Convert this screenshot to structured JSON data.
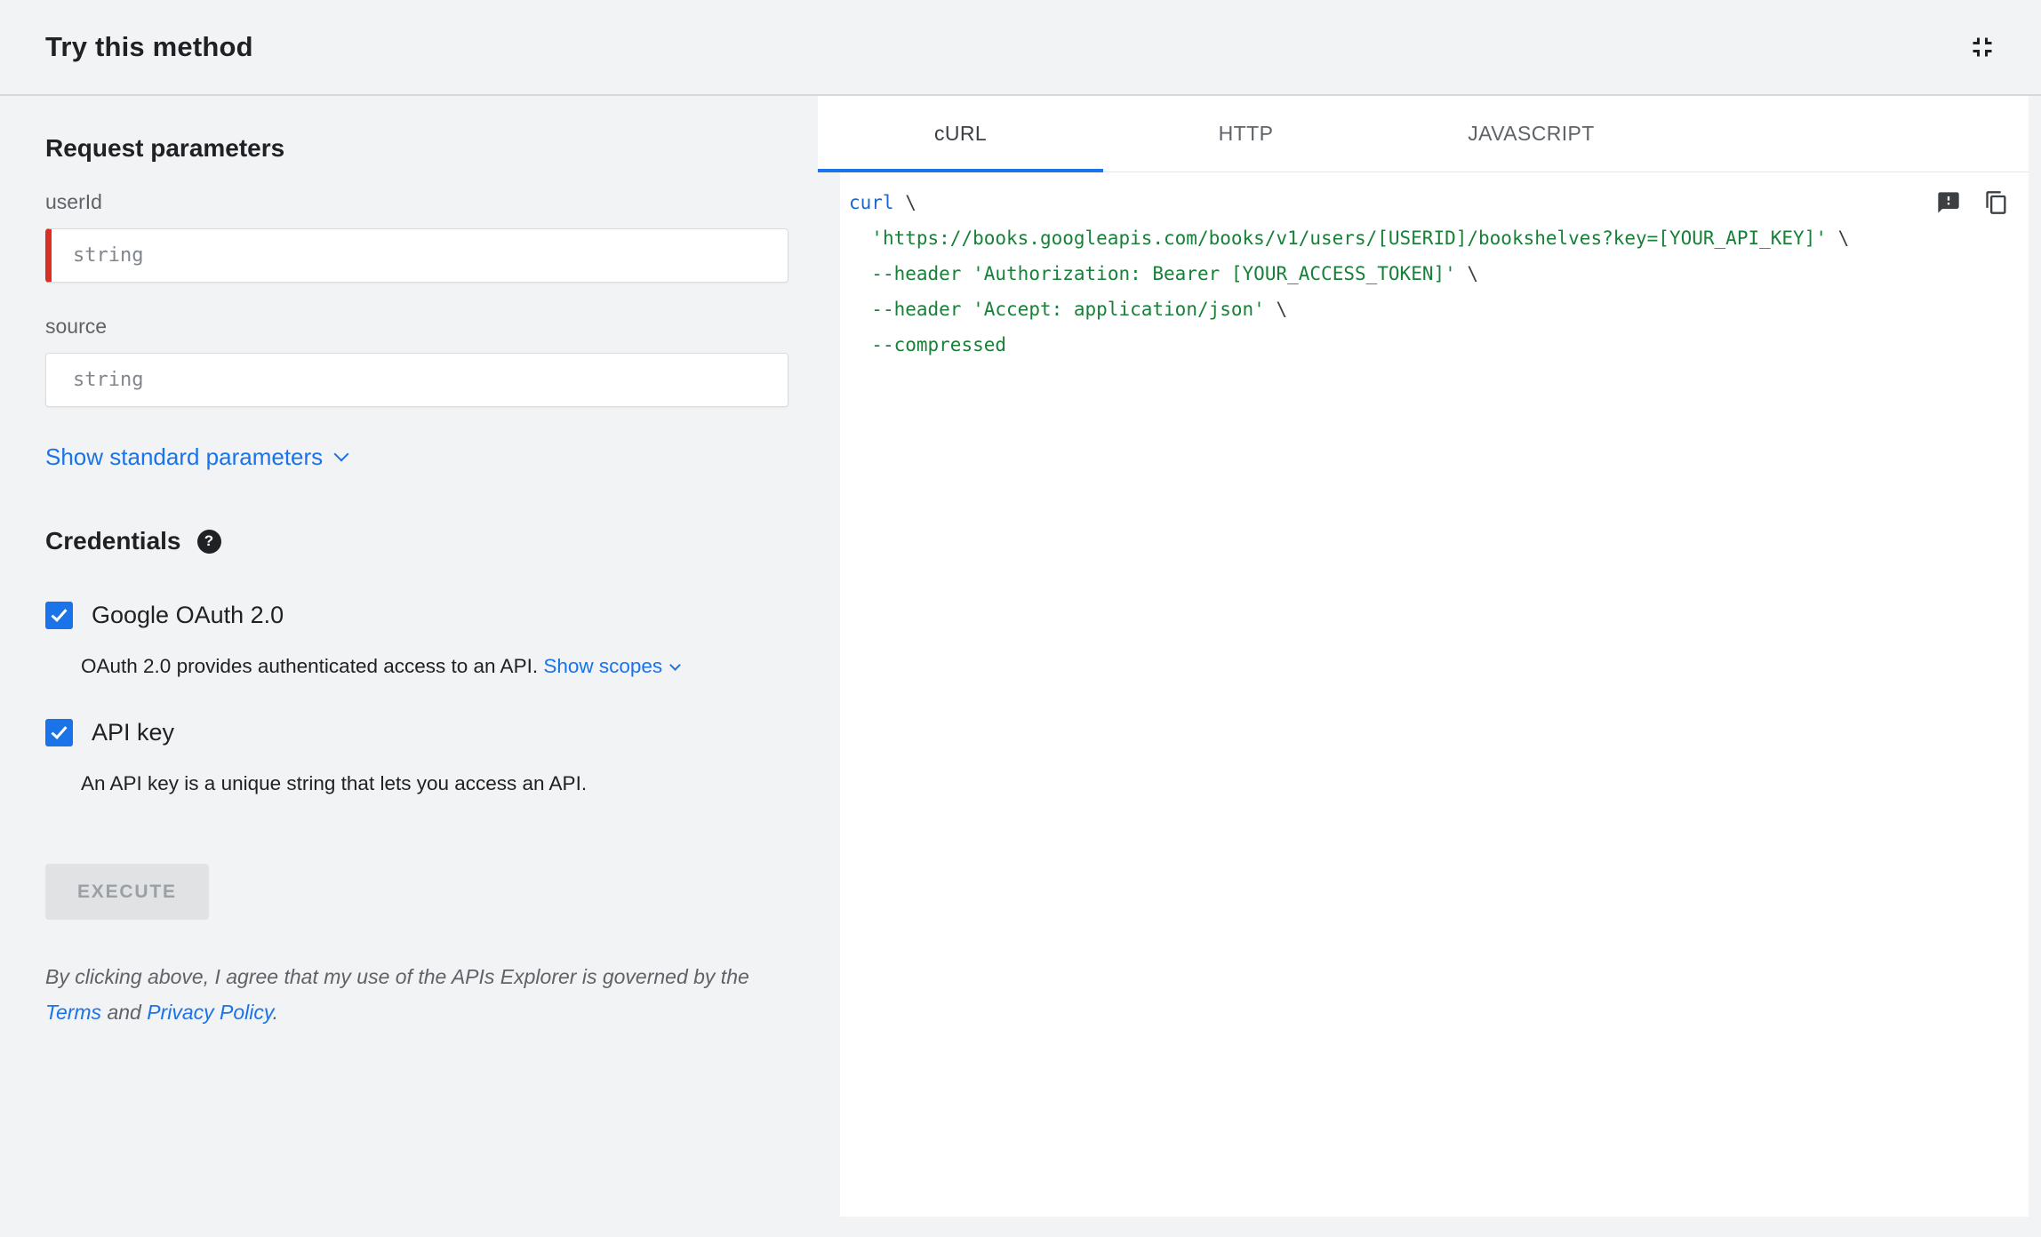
{
  "header": {
    "title": "Try this method"
  },
  "params": {
    "heading": "Request parameters",
    "fields": [
      {
        "label": "userId",
        "placeholder": "string",
        "required": true
      },
      {
        "label": "source",
        "placeholder": "string",
        "required": false
      }
    ],
    "show_standard_label": "Show standard parameters"
  },
  "credentials": {
    "heading": "Credentials",
    "oauth": {
      "label": "Google OAuth 2.0",
      "checked": true,
      "description": "OAuth 2.0 provides authenticated access to an API.",
      "scopes_link": "Show scopes"
    },
    "api_key": {
      "label": "API key",
      "checked": true,
      "description": "An API key is a unique string that lets you access an API."
    }
  },
  "execute_label": "EXECUTE",
  "disclaimer": {
    "prefix": "By clicking above, I agree that my use of the APIs Explorer is governed by the ",
    "terms_link": "Terms",
    "and": " and ",
    "privacy_link": "Privacy Policy",
    "suffix": "."
  },
  "tabs": [
    {
      "label": "cURL",
      "active": true
    },
    {
      "label": "HTTP",
      "active": false
    },
    {
      "label": "JAVASCRIPT",
      "active": false
    }
  ],
  "code": {
    "lines": [
      [
        {
          "t": "curl",
          "c": "kw"
        },
        {
          "t": " \\",
          "c": "plain"
        }
      ],
      [
        {
          "t": "  ",
          "c": "plain"
        },
        {
          "t": "'https://books.googleapis.com/books/v1/users/[USERID]/bookshelves?key=[YOUR_API_KEY]'",
          "c": "str"
        },
        {
          "t": " \\",
          "c": "plain"
        }
      ],
      [
        {
          "t": "  ",
          "c": "plain"
        },
        {
          "t": "--header",
          "c": "flag"
        },
        {
          "t": " ",
          "c": "plain"
        },
        {
          "t": "'Authorization: Bearer [YOUR_ACCESS_TOKEN]'",
          "c": "str"
        },
        {
          "t": " \\",
          "c": "plain"
        }
      ],
      [
        {
          "t": "  ",
          "c": "plain"
        },
        {
          "t": "--header",
          "c": "flag"
        },
        {
          "t": " ",
          "c": "plain"
        },
        {
          "t": "'Accept: application/json'",
          "c": "str"
        },
        {
          "t": " \\",
          "c": "plain"
        }
      ],
      [
        {
          "t": "  ",
          "c": "plain"
        },
        {
          "t": "--compressed",
          "c": "flag"
        }
      ]
    ]
  },
  "icons": {
    "help_glyph": "?",
    "collapse": "collapse-icon",
    "feedback": "feedback-icon",
    "copy": "copy-icon",
    "chevron": "chevron-down-icon",
    "check": "check-icon"
  },
  "colors": {
    "link-blue": "#1a73e8",
    "tab-underline": "#1a73e8",
    "checkbox-blue": "#1a73e8",
    "required-red": "#d93025",
    "code-keyword": "#1967d2",
    "code-string": "#188038",
    "code-flag": "#188038",
    "code-plain": "#3c4043"
  }
}
